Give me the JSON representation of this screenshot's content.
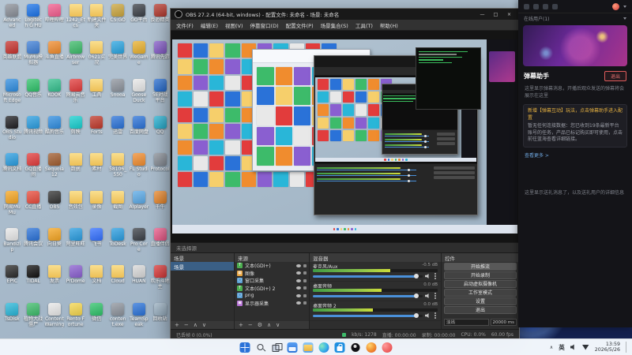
{
  "colors": {
    "accent": "#4a90d9",
    "meter_green": "#8bc34a",
    "meter_yellow": "#cddc39",
    "danger_red": "#e05c5c",
    "selection_blue": "#3a5f85"
  },
  "desktop": {
    "icons": [
      {
        "l": "Advanced",
        "c": "#8a8f98"
      },
      {
        "l": "Logitech G HUB",
        "c": "#1b73e8"
      },
      {
        "l": "哔哩哔哩",
        "c": "#f25d8e"
      },
      {
        "l": "1242_Etcs",
        "c": "#f6cf6b",
        "f": true
      },
      {
        "l": "新建文件夹",
        "c": "#f6cf6b",
        "f": true
      },
      {
        "l": "CS:GO",
        "c": "#caa53d"
      },
      {
        "l": "GO平台",
        "c": "#3a3f46"
      },
      {
        "l": "反恐精英",
        "c": "#b53a2f"
      },
      {
        "l": "英雄联盟",
        "c": "#c7342f"
      },
      {
        "l": "MuMu模拟器",
        "c": "#3f7fd6"
      },
      {
        "l": "斗鱼直播",
        "c": "#f08c2e"
      },
      {
        "l": "Airbrowser",
        "c": "#3dbb6a"
      },
      {
        "l": "0621实况",
        "c": "#f6cf6b",
        "f": true
      },
      {
        "l": "完美世界",
        "c": "#2aa4e0"
      },
      {
        "l": "WeGame",
        "c": "#e8b02e"
      },
      {
        "l": "腾讯先游",
        "c": "#8a5fd0"
      },
      {
        "l": "Microsoft Edge",
        "c": "#2f8de0"
      },
      {
        "l": "QQ音乐",
        "c": "#2fc26a"
      },
      {
        "l": "KOOK",
        "c": "#35c08e"
      },
      {
        "l": "网易云音乐",
        "c": "#e23c3c"
      },
      {
        "l": "工具",
        "c": "#f6cf6b",
        "f": true
      },
      {
        "l": "Snooa",
        "c": "#8d939c"
      },
      {
        "l": "Goose Duck",
        "c": "#e8e8e8"
      },
      {
        "l": "5E对战平台",
        "c": "#2a72d8"
      },
      {
        "l": "OBS Studio",
        "c": "#1f1f23"
      },
      {
        "l": "腾讯视频",
        "c": "#2a9de0"
      },
      {
        "l": "酷狗音乐",
        "c": "#2f8de0"
      },
      {
        "l": "剪映",
        "c": "#17cfcf"
      },
      {
        "l": "Forts",
        "c": "#c0392b"
      },
      {
        "l": "迅雷",
        "c": "#2a72d8"
      },
      {
        "l": "百度网盘",
        "c": "#2a72d8"
      },
      {
        "l": "QQ",
        "c": "#29b6d8"
      },
      {
        "l": "腾讯文档",
        "c": "#2a9de0"
      },
      {
        "l": "GQ直播间",
        "c": "#e23c3c"
      },
      {
        "l": "Sequoia 12",
        "c": "#a05c2e"
      },
      {
        "l": "数据",
        "c": "#f6cf6b",
        "f": true
      },
      {
        "l": "素材",
        "c": "#f6cf6b",
        "f": true
      },
      {
        "l": "58106_550",
        "c": "#f6cf6b",
        "f": true
      },
      {
        "l": "FL Studio",
        "c": "#f08c2e"
      },
      {
        "l": "Protocol",
        "c": "#8d939c"
      },
      {
        "l": "网易MuMu",
        "c": "#f5a623"
      },
      {
        "l": "CC直播",
        "c": "#e84c3d"
      },
      {
        "l": "OBS",
        "c": "#333333"
      },
      {
        "l": "音效包",
        "c": "#f6cf6b",
        "f": true
      },
      {
        "l": "录像",
        "c": "#f6cf6b",
        "f": true
      },
      {
        "l": "截图",
        "c": "#f6cf6b",
        "f": true
      },
      {
        "l": "AIplayer",
        "c": "#5aa9e6"
      },
      {
        "l": "千牛",
        "c": "#f08c2e"
      },
      {
        "l": "Bandizip",
        "c": "#e8e8e8"
      },
      {
        "l": "腾讯会议",
        "c": "#2a72d8"
      },
      {
        "l": "向日葵",
        "c": "#f5a623"
      },
      {
        "l": "阿里旺旺",
        "c": "#2a9de0"
      },
      {
        "l": "飞书",
        "c": "#3370ff"
      },
      {
        "l": "ToDesk",
        "c": "#2a9de0"
      },
      {
        "l": "Pro Core",
        "c": "#3a3f46"
      },
      {
        "l": "直播伴侣",
        "c": "#f25d8e"
      },
      {
        "l": "EPIC",
        "c": "#2b2b2b"
      },
      {
        "l": "TIDAL",
        "c": "#111111"
      },
      {
        "l": "发票",
        "c": "#f6cf6b",
        "f": true
      },
      {
        "l": "PrDome",
        "c": "#8a5fd0"
      },
      {
        "l": "文档",
        "c": "#f6cf6b",
        "f": true
      },
      {
        "l": "Cloud",
        "c": "#f6cf6b",
        "f": true
      },
      {
        "l": "HUAN",
        "c": "#d8d8d8"
      },
      {
        "l": "欢乐斗地主",
        "c": "#e23c3c"
      },
      {
        "l": "TsDisk",
        "c": "#29b6d8"
      },
      {
        "l": "植物大战僵尸",
        "c": "#3dbb6a"
      },
      {
        "l": "Content Warning",
        "c": "#e8e8e8"
      },
      {
        "l": "Rento Fortune",
        "c": "#f5d64e"
      },
      {
        "l": "微信",
        "c": "#2fc26a"
      },
      {
        "l": "content.exe",
        "c": "#8d939c"
      },
      {
        "l": "TeamSpeak",
        "c": "#2a72d8"
      },
      {
        "l": "回收站",
        "c": "#9fb6c8"
      }
    ]
  },
  "obs": {
    "window_title": "OBS 27.2.4 (64-bit, windows) - 配置文件: 未命名 - 场景: 未命名",
    "window_buttons": [
      "—",
      "□",
      "×"
    ],
    "menus": [
      "文件(F)",
      "编辑(E)",
      "视图(V)",
      "停靠窗口(D)",
      "配置文件(P)",
      "场景集合(S)",
      "工具(T)",
      "帮助(H)"
    ],
    "selected_source_hint": "未选择源",
    "scenes": {
      "title": "场景",
      "items": [
        "场景"
      ],
      "footer": [
        "+",
        "−",
        "∧",
        "∨"
      ]
    },
    "sources": {
      "title": "来源",
      "footer": [
        "+",
        "−",
        "⚙",
        "∧",
        "∨"
      ],
      "items": [
        {
          "g": "T",
          "c": "#4caf50",
          "l": "文本(GDI+)"
        },
        {
          "g": "▦",
          "c": "#e8a33d",
          "l": "图像"
        },
        {
          "g": "▢",
          "c": "#5a9fd4",
          "l": "窗口采集"
        },
        {
          "g": "T",
          "c": "#4caf50",
          "l": "文本(GDI+) 2"
        },
        {
          "g": "▢",
          "c": "#5a9fd4",
          "l": "png"
        },
        {
          "g": "▣",
          "c": "#b56fd4",
          "l": "显示器采集"
        }
      ]
    },
    "mixer": {
      "title": "混音器",
      "channels": [
        {
          "name": "麦克风/Aux",
          "db": "-0.5 dB",
          "meter": 62
        },
        {
          "name": "桌面音频",
          "db": "0.0 dB",
          "meter": 55
        },
        {
          "name": "桌面音频 2",
          "db": "0.0 dB",
          "meter": 48
        }
      ]
    },
    "controls": {
      "title": "控件",
      "buttons": [
        "开始推流",
        "开始录制",
        "启动虚拟摄像机",
        "工作室模式",
        "设置",
        "退出"
      ],
      "transition": {
        "select": "淡出",
        "duration": "20000 ms"
      }
    },
    "statusbar": {
      "dropped": "已丢帧 0 (0.0%)",
      "kbps": "kb/s: 1278",
      "live": "直播: 00:00:00",
      "rec": "录制: 00:00:00",
      "cpu": "CPU: 0.0%",
      "fps": "60.00 fps"
    }
  },
  "assistant": {
    "header_icons": [
      "apps-icon",
      "music-icon",
      "cast-icon",
      "bell-icon",
      "avatar",
      "chevron-down-icon"
    ],
    "online": "在线用户(1)",
    "title": "弹幕助手",
    "quit": "退出",
    "p1": "这里显示弹幕消息，开播后观众发送的弹幕将会展示在这里",
    "notice_title": "新增【弹幕互动】玩法，点击弹幕助手进入配置",
    "notice_body": "暂无任何连接数据：您已收到19条最新平台账号的任务，产品已标记购买即可使用，点击前往蓝海查看详细链接。",
    "more": "查看更多 >",
    "p2": "这里显示送礼消息了，以及送礼用户的详细信息"
  },
  "taskbar": {
    "center_icons": [
      "start",
      "search",
      "task-view",
      "widgets",
      "file-explorer",
      "edge",
      "store",
      "obs",
      "firefox",
      "chat"
    ],
    "tray_caret": "∧",
    "ime": "英",
    "time": "13:59",
    "date": "2026/5/26"
  }
}
